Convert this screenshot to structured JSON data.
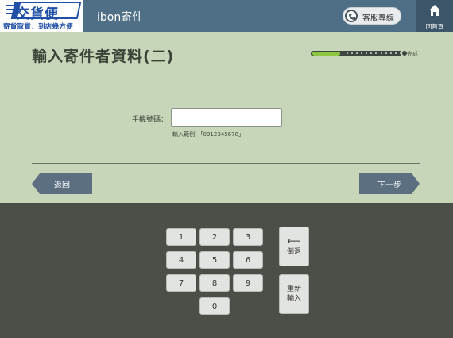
{
  "header": {
    "logo_text": "交貨便",
    "logo_slogan": "寄貨取貨．到店幾方便",
    "app_title": "ibon寄件",
    "hotline_label": "客服專線",
    "home_label": "回首頁"
  },
  "page": {
    "title": "輸入寄件者資料(二)",
    "progress": {
      "label": "完成",
      "fraction": 0.3
    }
  },
  "form": {
    "phone_label": "手機號碼：",
    "phone_value": "",
    "phone_hint": "輸入範例：「0912345678」"
  },
  "navigation": {
    "back_label": "返回",
    "next_label": "下一步"
  },
  "keypad": {
    "keys": [
      "1",
      "2",
      "3",
      "4",
      "5",
      "6",
      "7",
      "8",
      "9",
      "0"
    ],
    "backspace_label": "倒退",
    "reset_label_line1": "重新",
    "reset_label_line2": "輸入"
  },
  "colors": {
    "topbar": "#4f6f86",
    "content_bg": "#c7d6b8",
    "keypad_bg": "#4a4f47",
    "nav_button": "#5c6f80",
    "progress_fill": "#8fc63f",
    "logo_blue": "#1f4fa6"
  }
}
